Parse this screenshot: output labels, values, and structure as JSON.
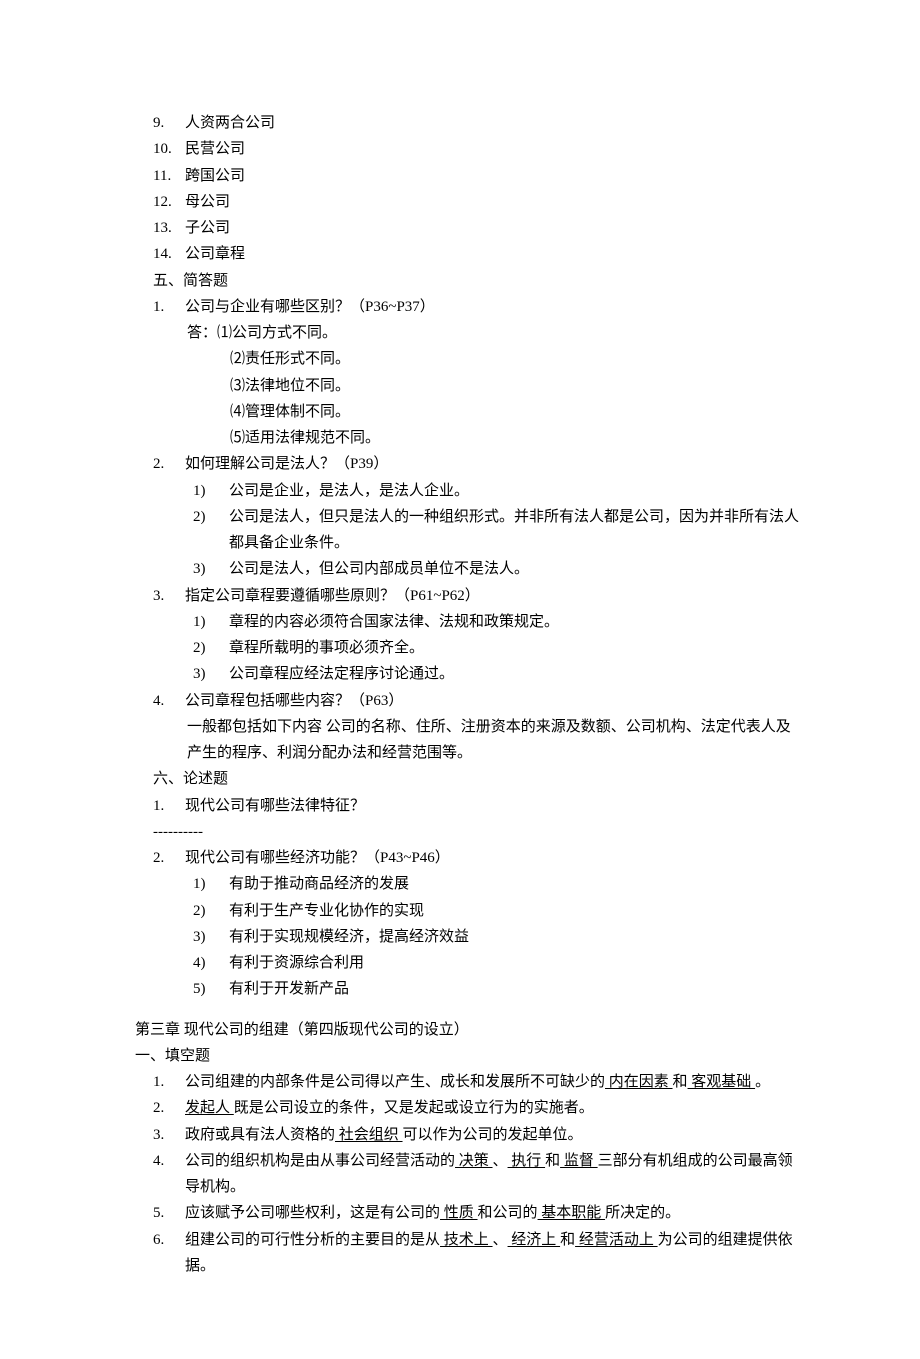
{
  "topList": [
    {
      "num": "9.",
      "text": "人资两合公司"
    },
    {
      "num": "10.",
      "text": "民营公司"
    },
    {
      "num": "11.",
      "text": "跨国公司"
    },
    {
      "num": "12.",
      "text": "母公司"
    },
    {
      "num": "13.",
      "text": "子公司"
    },
    {
      "num": "14.",
      "text": "公司章程"
    }
  ],
  "section5": {
    "header": "五、简答题",
    "q1": {
      "num": "1.",
      "text": "公司与企业有哪些区别？（P36~P37）",
      "answerPrefix": "答：",
      "answers": [
        "⑴公司方式不同。",
        "⑵责任形式不同。",
        "⑶法律地位不同。",
        "⑷管理体制不同。",
        "⑸适用法律规范不同。"
      ]
    },
    "q2": {
      "num": "2.",
      "text": "如何理解公司是法人？（P39）",
      "subs": [
        {
          "num": "1)",
          "text": "公司是企业，是法人，是法人企业。"
        },
        {
          "num": "2)",
          "text": "公司是法人，但只是法人的一种组织形式。并非所有法人都是公司，因为并非所有法人都具备企业条件。"
        },
        {
          "num": "3)",
          "text": "公司是法人，但公司内部成员单位不是法人。"
        }
      ]
    },
    "q3": {
      "num": "3.",
      "text": "指定公司章程要遵循哪些原则？（P61~P62）",
      "subs": [
        {
          "num": "1)",
          "text": "章程的内容必须符合国家法律、法规和政策规定。"
        },
        {
          "num": "2)",
          "text": "章程所载明的事项必须齐全。"
        },
        {
          "num": "3)",
          "text": "公司章程应经法定程序讨论通过。"
        }
      ]
    },
    "q4": {
      "num": "4.",
      "text": "公司章程包括哪些内容？（P63）",
      "content": "一般都包括如下内容 公司的名称、住所、注册资本的来源及数额、公司机构、法定代表人及产生的程序、利润分配办法和经营范围等。"
    }
  },
  "section6": {
    "header": "六、论述题",
    "q1": {
      "num": "1.",
      "text": "现代公司有哪些法律特征？"
    },
    "dashes": "----------",
    "q2": {
      "num": "2.",
      "text": "现代公司有哪些经济功能？（P43~P46）",
      "subs": [
        {
          "num": "1)",
          "text": "有助于推动商品经济的发展"
        },
        {
          "num": "2)",
          "text": "有利于生产专业化协作的实现"
        },
        {
          "num": "3)",
          "text": "有利于实现规模经济，提高经济效益"
        },
        {
          "num": "4)",
          "text": "有利于资源综合利用"
        },
        {
          "num": "5)",
          "text": "有利于开发新产品"
        }
      ]
    }
  },
  "chapter3": {
    "title": "第三章  现代公司的组建（第四版现代公司的设立）",
    "sectionHeader": "一、填空题",
    "fills": {
      "f1": {
        "num": "1.",
        "pre": "公司组建的内部条件是公司得以产生、成长和发展所不可缺少的",
        "u1": " 内在因素 ",
        "mid1": "和",
        "u2": " 客观基础 ",
        "post": "。"
      },
      "f2": {
        "num": "2.",
        "u1": " 发起人 ",
        "post": "既是公司设立的条件，又是发起或设立行为的实施者。"
      },
      "f3": {
        "num": "3.",
        "pre": "政府或具有法人资格的",
        "u1": " 社会组织 ",
        "post": "可以作为公司的发起单位。"
      },
      "f4": {
        "num": "4.",
        "pre": "公司的组织机构是由从事公司经营活动的",
        "u1": " 决策 ",
        "mid1": "、",
        "u2": " 执行 ",
        "mid2": "和",
        "u3": " 监督 ",
        "post": "三部分有机组成的公司最高领导机构。"
      },
      "f5": {
        "num": "5.",
        "pre": "应该赋予公司哪些权利，这是有公司的",
        "u1": " 性质 ",
        "mid1": "和公司的",
        "u2": " 基本职能 ",
        "post": "所决定的。"
      },
      "f6": {
        "num": "6.",
        "pre": "组建公司的可行性分析的主要目的是从",
        "u1": " 技术上 ",
        "mid1": "、",
        "u2": " 经济上 ",
        "mid2": "和",
        "u3": " 经营活动上 ",
        "post": "为公司的组建提供依据。"
      }
    }
  }
}
